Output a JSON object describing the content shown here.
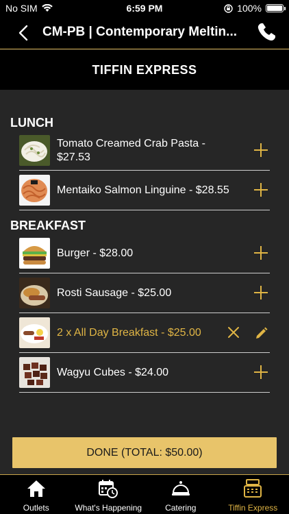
{
  "status": {
    "carrier": "No SIM",
    "time": "6:59 PM",
    "battery": "100%"
  },
  "nav": {
    "title": "CM-PB | Contemporary Meltin..."
  },
  "header": {
    "title": "TIFFIN EXPRESS"
  },
  "menu": {
    "lunch_label": "LUNCH",
    "breakfast_label": "BREAKFAST",
    "lunch": [
      {
        "label": "Tomato Creamed Crab Pasta  - $27.53"
      },
      {
        "label": "Mentaiko Salmon Linguine - $28.55"
      }
    ],
    "breakfast": [
      {
        "label": "Burger - $28.00"
      },
      {
        "label": "Rosti Sausage  - $25.00"
      },
      {
        "label": "2 x All Day Breakfast - $25.00"
      },
      {
        "label": "Wagyu Cubes - $24.00"
      }
    ]
  },
  "done_button": "DONE (TOTAL: $50.00)",
  "tabs": [
    {
      "label": "Outlets"
    },
    {
      "label": "What's Happening"
    },
    {
      "label": "Catering"
    },
    {
      "label": "Tiffin Express"
    }
  ],
  "colors": {
    "accent": "#e0b545",
    "button": "#e8c46a",
    "background": "#262626"
  }
}
